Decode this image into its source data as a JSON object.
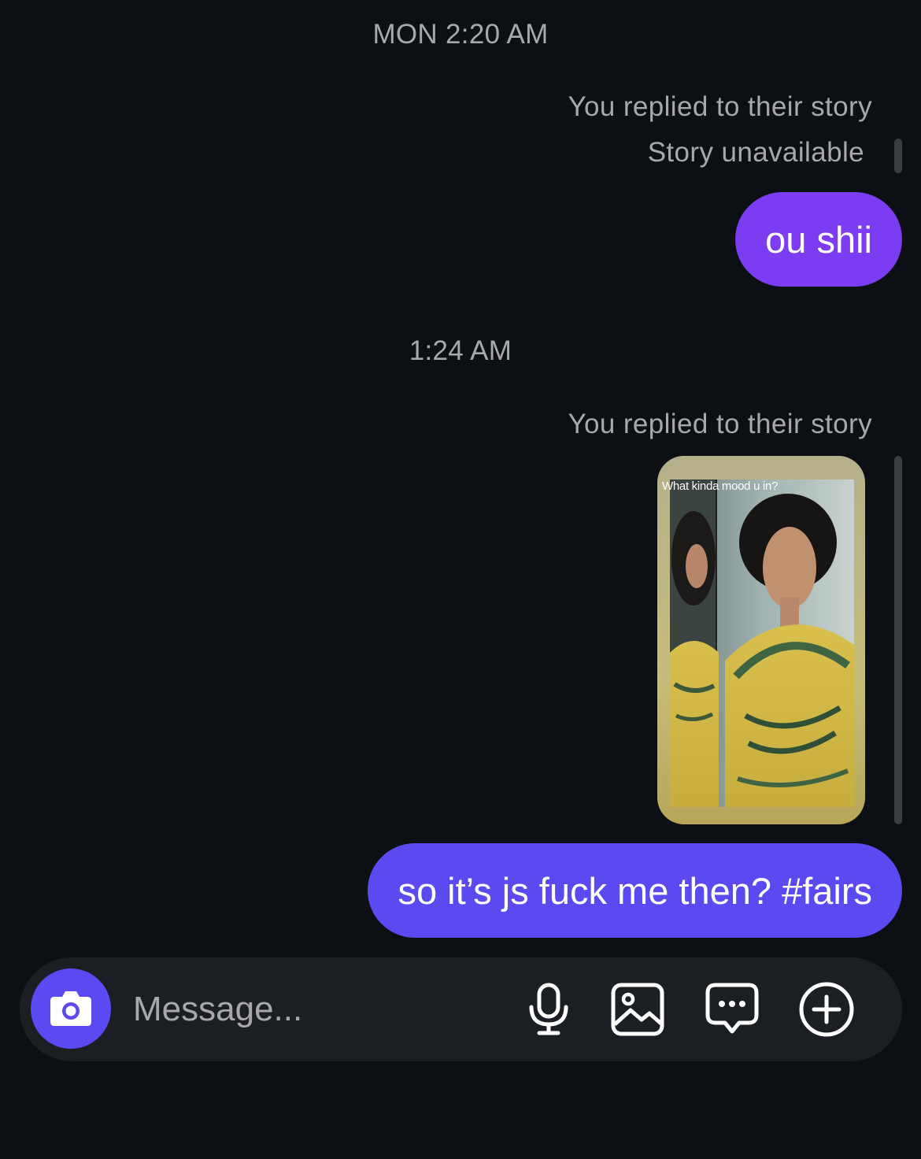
{
  "thread": {
    "timestamp_1": "MON 2:20 AM",
    "reply_note_1": "You replied to their story",
    "story_unavailable": "Story unavailable",
    "message_1": "ou shii",
    "timestamp_2": "1:24 AM",
    "reply_note_2": "You replied to their story",
    "story_caption": "What kinda mood u in?",
    "message_2": "so it’s js fuck me then? #fairs"
  },
  "composer": {
    "placeholder": "Message...",
    "icons": [
      "camera-icon",
      "microphone-icon",
      "gallery-icon",
      "sticker-chat-icon",
      "plus-circle-icon"
    ]
  },
  "colors": {
    "background": "#0c1014",
    "bubble_1": "#7b3cf2",
    "bubble_2": "#5b4af2",
    "camera_button": "#5b4af2",
    "composer": "#1b1f24",
    "secondary_text": "#a8a8a8"
  }
}
